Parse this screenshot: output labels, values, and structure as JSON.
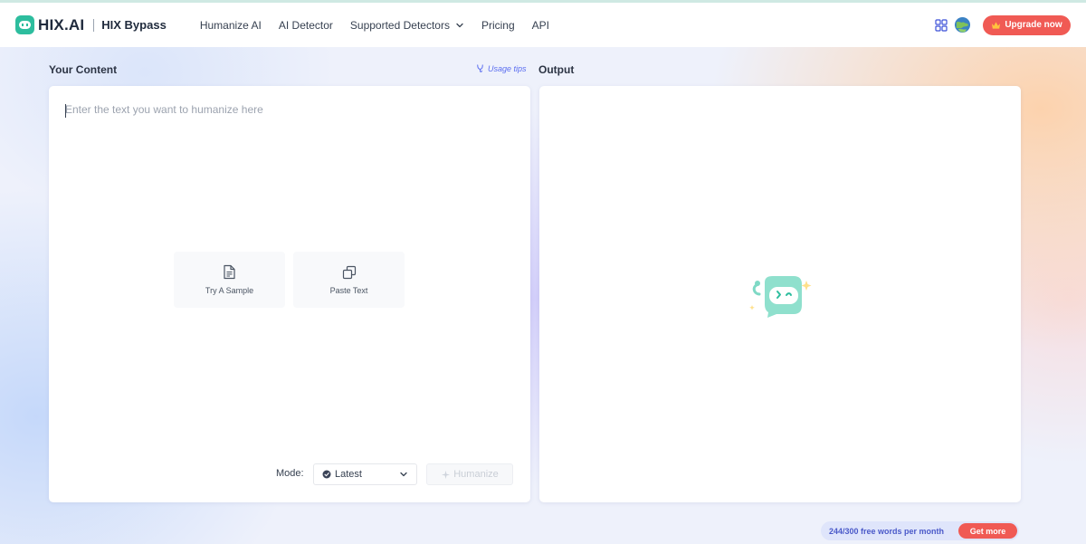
{
  "header": {
    "logo_text": "HIX.AI",
    "product_name": "HIX Bypass",
    "nav": [
      {
        "label": "Humanize AI"
      },
      {
        "label": "AI Detector"
      },
      {
        "label": "Supported Detectors"
      },
      {
        "label": "Pricing"
      },
      {
        "label": "API"
      }
    ],
    "upgrade_label": "Upgrade now",
    "accent_color": "#f05a54",
    "brand_color": "#2dbd9e"
  },
  "content": {
    "title": "Your Content",
    "usage_tips": "Usage tips",
    "input_placeholder": "Enter the text you want to humanize here",
    "input_value": "",
    "try_sample_label": "Try A Sample",
    "paste_text_label": "Paste Text",
    "mode_label": "Mode:",
    "mode_value": "Latest",
    "humanize_label": "Humanize"
  },
  "output": {
    "title": "Output"
  },
  "quota": {
    "text": "244/300 free words per month",
    "get_more_label": "Get more"
  },
  "icons": {
    "logo": "hix-robot-logo-icon",
    "chevron": "chevron-down-icon",
    "apps": "apps-grid-icon",
    "language": "globe-icon",
    "crown": "crown-icon",
    "tips": "tips-icon",
    "sample": "document-icon",
    "paste": "copy-icon",
    "mode": "mode-badge-icon",
    "humanize": "sparkle-icon",
    "placeholder": "robot-mascot-icon"
  }
}
